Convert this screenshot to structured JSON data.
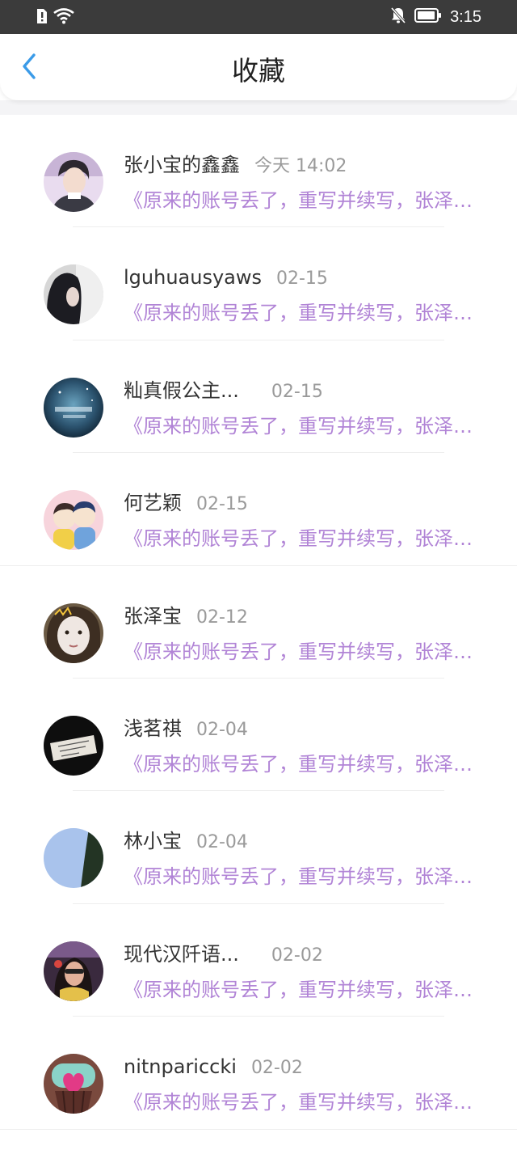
{
  "status_bar": {
    "time": "3:15",
    "icons": [
      "sim-alert-icon",
      "wifi-icon",
      "notifications-off-icon",
      "battery-icon"
    ]
  },
  "header": {
    "title": "收藏",
    "back_icon": "chevron-left-icon",
    "accent_color": "#3b9be8"
  },
  "colors": {
    "snippet": "#b184d6",
    "name": "#333333",
    "date": "#9a9a9a",
    "status_bar_bg": "#3b3b3b"
  },
  "favorites": [
    {
      "name": "张小宝的鑫鑫",
      "date": "今天 14:02",
      "snippet": "《原来的账号丢了，重写并续写，张泽宝》",
      "avatar": "avatar-photo-boy"
    },
    {
      "name": "lguhuausyaws",
      "date": "02-15",
      "snippet": "《原来的账号丢了，重写并续写，张泽宝》",
      "avatar": "avatar-photo-dark-hair"
    },
    {
      "name": "籼真假公主...",
      "date": "02-15",
      "snippet": "《原来的账号丢了，重写并续写，张泽宝》",
      "avatar": "avatar-photo-blue-night"
    },
    {
      "name": "何艺颖",
      "date": "02-15",
      "snippet": "《原来的账号丢了，重写并续写，张泽宝》",
      "avatar": "avatar-cartoon-couple"
    },
    {
      "name": "张泽宝",
      "date": "02-12",
      "snippet": "《原来的账号丢了，重写并续写，张泽宝》",
      "avatar": "avatar-photo-face"
    },
    {
      "name": "浅茗祺",
      "date": "02-04",
      "snippet": "《原来的账号丢了，重写并续写，张泽宝》",
      "avatar": "avatar-photo-note"
    },
    {
      "name": "林小宝",
      "date": "02-04",
      "snippet": "《原来的账号丢了，重写并续写，张泽宝》",
      "avatar": "avatar-photo-sky"
    },
    {
      "name": "现代汉阡语...",
      "date": "02-02",
      "snippet": "《原来的账号丢了，重写并续写，张泽宝》",
      "avatar": "avatar-photo-girl"
    },
    {
      "name": "nitnpariccki",
      "date": "02-02",
      "snippet": "《原来的账号丢了，重写并续写，张泽宝》",
      "avatar": "avatar-photo-cupcake"
    }
  ]
}
